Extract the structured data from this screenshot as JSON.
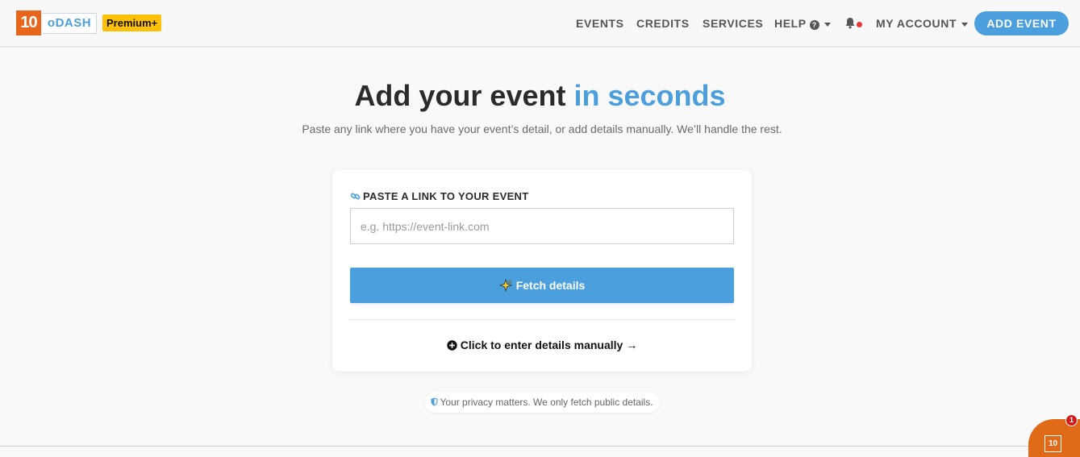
{
  "header": {
    "logo_number": "10",
    "logo_word": "oDASH",
    "plan_badge": "Premium+",
    "nav": {
      "events": "EVENTS",
      "credits": "CREDITS",
      "services": "SERVICES",
      "help": "HELP",
      "help_icon": "?",
      "my_account": "MY ACCOUNT"
    },
    "add_event": "ADD EVENT"
  },
  "hero": {
    "title_main": "Add your event ",
    "title_accent": "in seconds",
    "subtitle": "Paste any link where you have your event’s detail, or add details manually. We’ll handle the rest."
  },
  "card": {
    "label": "PASTE A LINK TO YOUR EVENT",
    "input_value": "",
    "input_placeholder": "e.g. https://event-link.com",
    "fetch_button": "Fetch details",
    "manual_link": "Click to enter details manually →"
  },
  "privacy": "Your privacy matters. We only fetch public details.",
  "widget": {
    "logo": "10",
    "badge_count": "1"
  },
  "colors": {
    "accent": "#4a9fdc",
    "brand_orange": "#e8661b",
    "premium_yellow": "#ffc107",
    "notification_red": "#e53935"
  },
  "icons": [
    "link-icon",
    "sparkle-icon",
    "plus-circle-icon",
    "shield-icon",
    "bell-icon",
    "question-circle-icon",
    "caret-down-icon"
  ]
}
